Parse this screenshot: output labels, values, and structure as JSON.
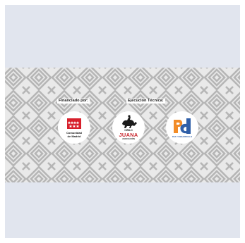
{
  "banner": {
    "funded_label": "Financiado por:",
    "execution_label": "Ejecucion Técnica:"
  },
  "logos": {
    "comunidad": {
      "line1": "Comunidad",
      "line2": "de Madrid",
      "flag_color": "#d7202c"
    },
    "cirilo_juana": {
      "top": "CIRILO",
      "name": "JUANA",
      "bottom": "ASOCIACIÓN"
    },
    "pd": {
      "letters": "Pd",
      "caption": "PAZ Y DESARROLLO",
      "orange": "#f28c28",
      "blue": "#2f5fa8"
    }
  },
  "colors": {
    "page_background": "#e1e5ee",
    "pattern_background": "#e9e9e9",
    "pattern_stroke": "#b6b6b6"
  }
}
